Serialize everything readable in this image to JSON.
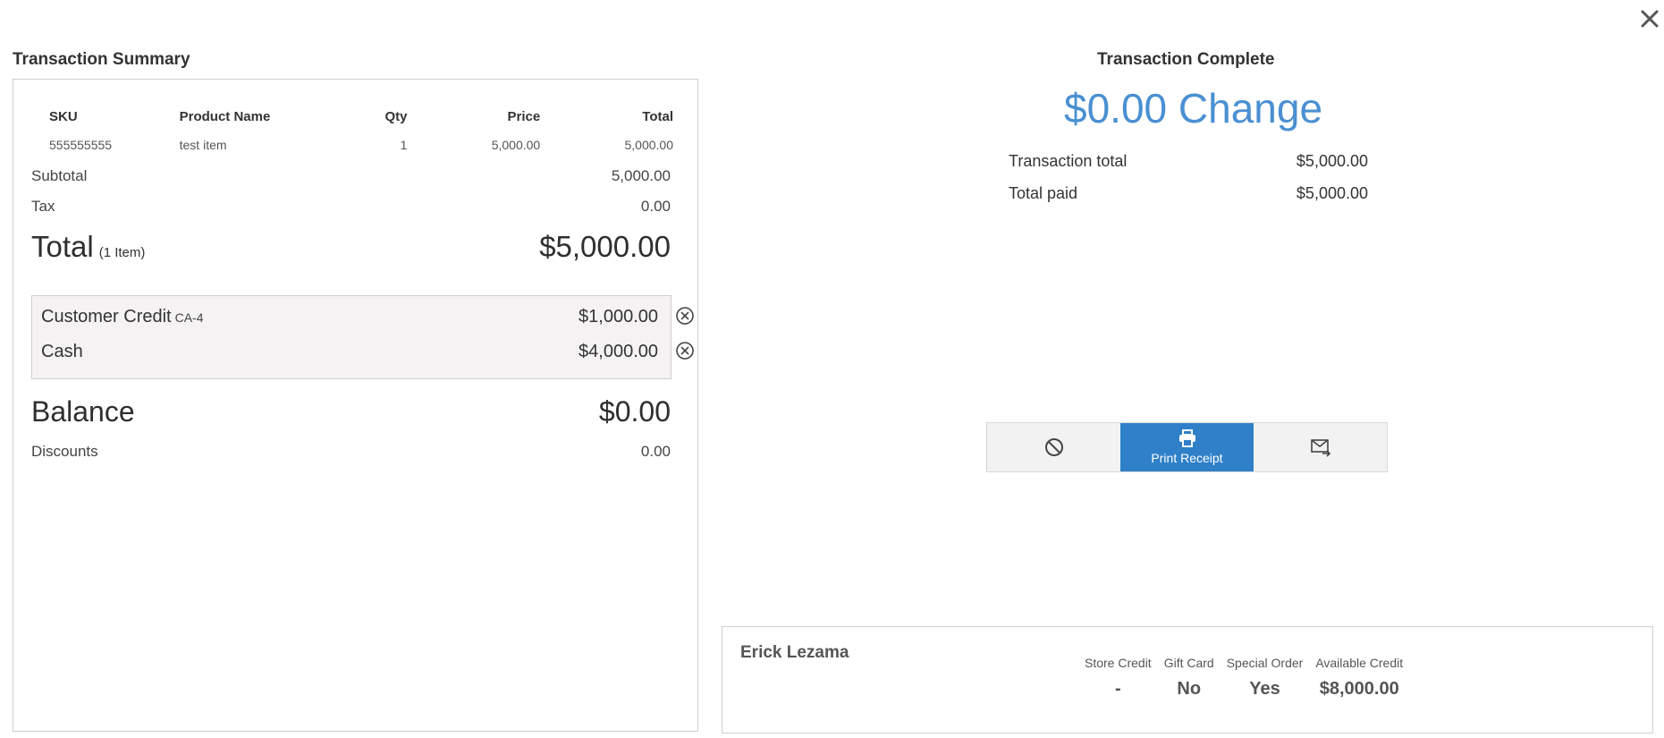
{
  "close_icon": "close-x-icon",
  "summary": {
    "title": "Transaction Summary",
    "columns": [
      "SKU",
      "Product Name",
      "Qty",
      "Price",
      "Total"
    ],
    "rows": [
      {
        "sku": "555555555",
        "name": "test item",
        "qty": "1",
        "price": "5,000.00",
        "total": "5,000.00"
      }
    ],
    "subtotal_label": "Subtotal",
    "subtotal_value": "5,000.00",
    "tax_label": "Tax",
    "tax_value": "0.00",
    "total_label": "Total",
    "total_items": "(1 Item)",
    "total_value": "$5,000.00",
    "payments": [
      {
        "method": "Customer Credit",
        "ref": "CA-4",
        "amount": "$1,000.00"
      },
      {
        "method": "Cash",
        "ref": "",
        "amount": "$4,000.00"
      }
    ],
    "balance_label": "Balance",
    "balance_value": "$0.00",
    "discounts_label": "Discounts",
    "discounts_value": "0.00"
  },
  "complete": {
    "title": "Transaction Complete",
    "change": "$0.00 Change",
    "transaction_total_label": "Transaction total",
    "transaction_total_value": "$5,000.00",
    "total_paid_label": "Total paid",
    "total_paid_value": "$5,000.00"
  },
  "actions": {
    "no_receipt_icon": "ban-icon",
    "print_icon": "printer-icon",
    "print_label": "Print Receipt",
    "email_icon": "email-send-icon"
  },
  "customer": {
    "name": "Erick Lezama",
    "stats": [
      {
        "label": "Store Credit",
        "value": "-"
      },
      {
        "label": "Gift Card",
        "value": "No"
      },
      {
        "label": "Special Order",
        "value": "Yes"
      },
      {
        "label": "Available Credit",
        "value": "$8,000.00"
      }
    ]
  },
  "colors": {
    "accent": "#2f80c8",
    "change_text": "#4a90d2",
    "payment_bg": "#f4f2f2"
  }
}
